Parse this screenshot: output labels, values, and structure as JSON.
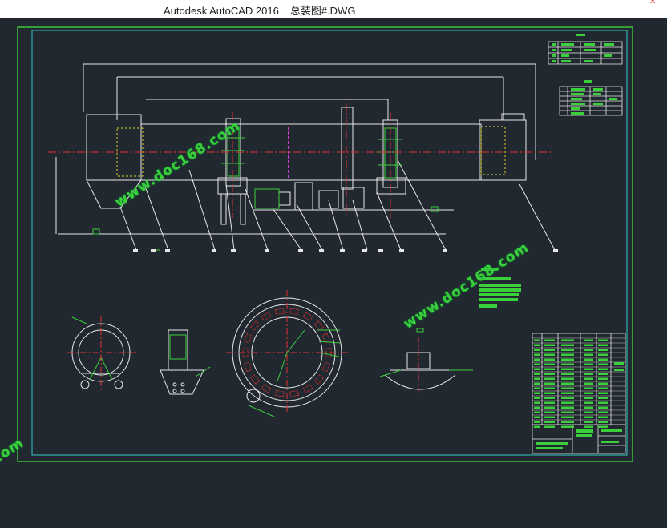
{
  "window": {
    "app_name": "Autodesk AutoCAD 2016",
    "file_name": "总装图#.DWG"
  },
  "watermarks": [
    "www.doc168.com",
    "www.doc168.com",
    "www.doc168.com"
  ],
  "colors": {
    "background": "#212830",
    "frame_green": "#3ccf3c",
    "frame_cyan": "#38c8c8",
    "geometry_white": "#e8e8e8",
    "axis_red": "#e03030",
    "hidden_yellow": "#e0d030",
    "accent_magenta": "#d040d0"
  },
  "icons": {
    "close": "close-icon"
  }
}
